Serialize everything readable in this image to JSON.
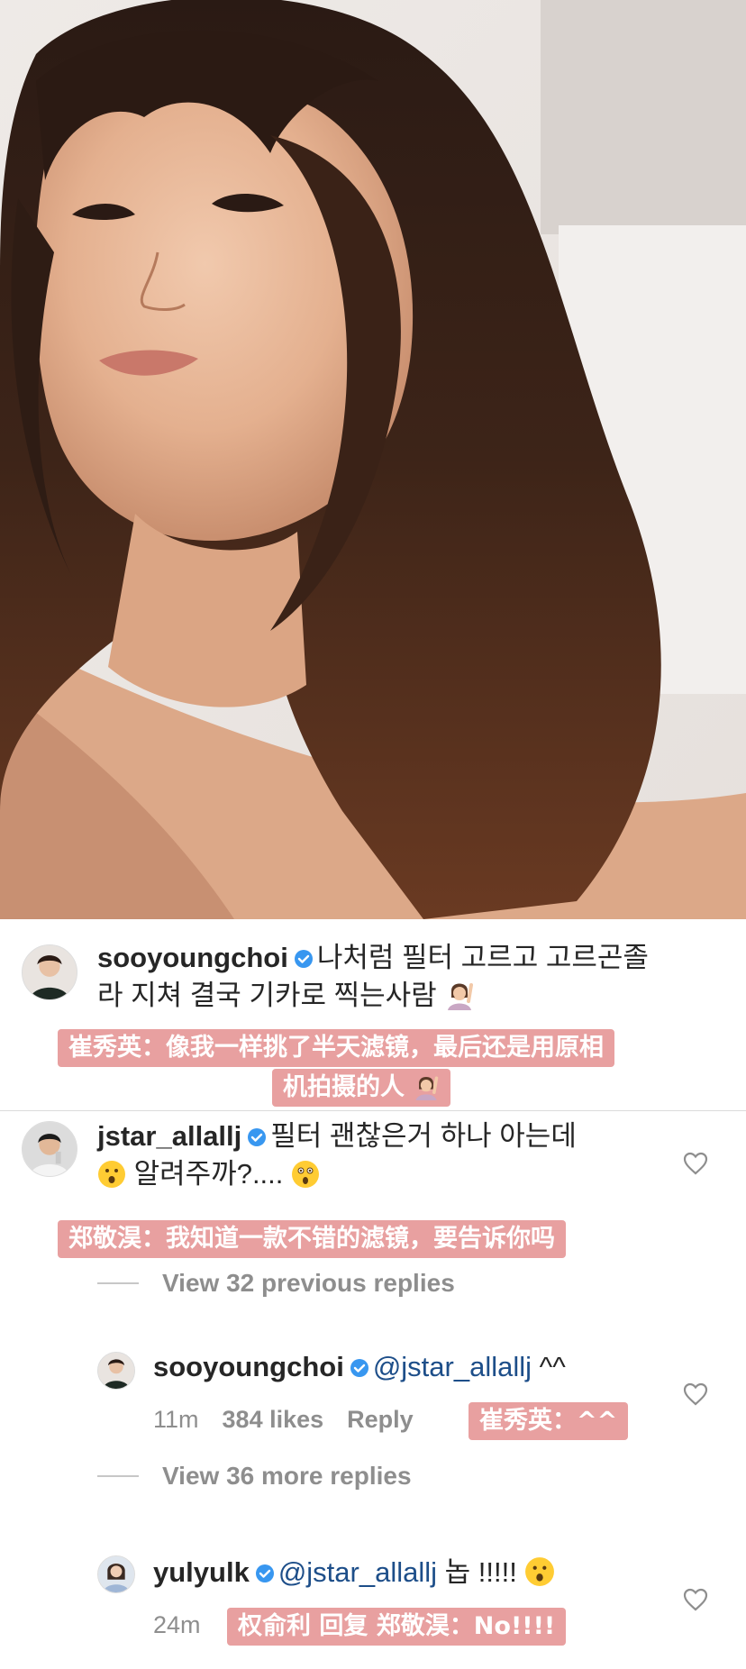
{
  "photo": {
    "icon": "selfie-photo"
  },
  "caption": {
    "username": "sooyoungchoi",
    "text_line1": "나처럼 필터 고르고 고르곤졸",
    "text_line2": "라 지쳐 결국 기카로 찍는사람",
    "translation_line1": "崔秀英：像我一样挑了半天滤镜，最后还是用原相",
    "translation_line2": "机拍摄的人"
  },
  "comment1": {
    "username": "jstar_allallj",
    "text_line1": "필터 괜찮은거 하나 아는데",
    "text_line2": "알려주까?....",
    "translation": "郑敬淏：我知道一款不错的滤镜，要告诉你吗",
    "view_previous": "View 32 previous replies"
  },
  "reply1": {
    "username": "sooyoungchoi",
    "mention": "@jstar_allallj",
    "text": "^^",
    "time": "11m",
    "likes": "384 likes",
    "reply_label": "Reply",
    "translation": "崔秀英：^^",
    "view_more": "View 36 more replies"
  },
  "reply2": {
    "username": "yulyulk",
    "mention": "@jstar_allallj",
    "text": "놉 !!!!!",
    "time": "24m",
    "translation": "权俞利 回复 郑敬淏：No!!!!"
  },
  "colors": {
    "translation_bg": "#e8a0a0",
    "verified_blue": "#3897f0",
    "mention": "#1d4e89",
    "meta_gray": "#8e8e8e"
  }
}
